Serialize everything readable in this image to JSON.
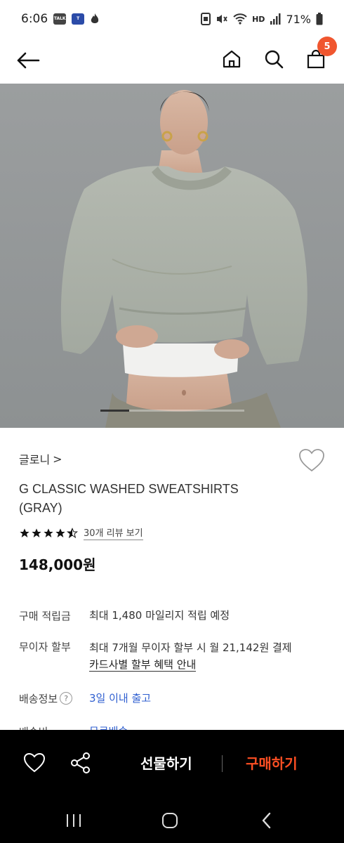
{
  "status": {
    "time": "6:06",
    "battery": "71%",
    "talk_badge": "TALK",
    "store_badge": "T",
    "hd": "HD"
  },
  "header": {
    "cart_count": "5"
  },
  "product": {
    "brand": "글로니",
    "brand_chevron": ">",
    "title": "G CLASSIC WASHED SWEATSHIRTS (GRAY)",
    "rating": 4.5,
    "review_link": "30개 리뷰 보기",
    "price": "148,000원",
    "image_pager": {
      "current": 1,
      "total": 5
    }
  },
  "info": {
    "points_label": "구매 적립금",
    "points_value": "최대 1,480 마일리지 적립 예정",
    "installment_label": "무이자 할부",
    "installment_value": "최대 7개월 무이자 할부 시 월 21,142원 결제",
    "installment_link": "카드사별 할부 혜택 안내",
    "shipping_label": "배송정보",
    "shipping_help": "?",
    "shipping_value": "3일 이내 출고",
    "fee_label": "배송비",
    "fee_value": "무료배송"
  },
  "bottom": {
    "gift_label": "선물하기",
    "buy_label": "구매하기"
  },
  "colors": {
    "accent": "#ff4f23",
    "badge": "#f0562f",
    "link_blue": "#2f5fd0"
  }
}
